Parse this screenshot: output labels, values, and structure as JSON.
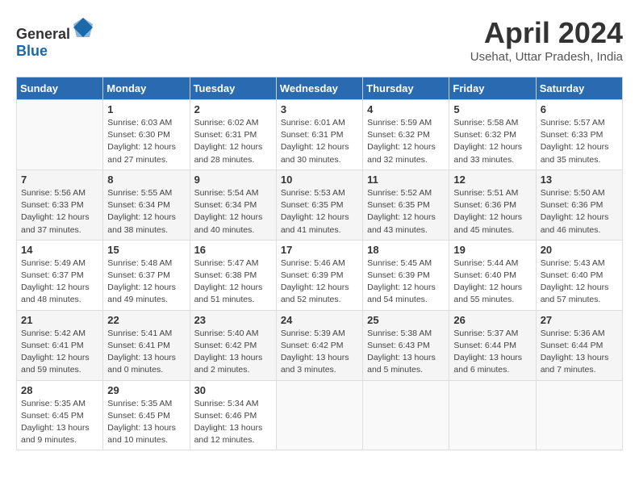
{
  "header": {
    "logo_general": "General",
    "logo_blue": "Blue",
    "month_year": "April 2024",
    "location": "Usehat, Uttar Pradesh, India"
  },
  "weekdays": [
    "Sunday",
    "Monday",
    "Tuesday",
    "Wednesday",
    "Thursday",
    "Friday",
    "Saturday"
  ],
  "rows": [
    [
      {
        "day": "",
        "info": ""
      },
      {
        "day": "1",
        "info": "Sunrise: 6:03 AM\nSunset: 6:30 PM\nDaylight: 12 hours\nand 27 minutes."
      },
      {
        "day": "2",
        "info": "Sunrise: 6:02 AM\nSunset: 6:31 PM\nDaylight: 12 hours\nand 28 minutes."
      },
      {
        "day": "3",
        "info": "Sunrise: 6:01 AM\nSunset: 6:31 PM\nDaylight: 12 hours\nand 30 minutes."
      },
      {
        "day": "4",
        "info": "Sunrise: 5:59 AM\nSunset: 6:32 PM\nDaylight: 12 hours\nand 32 minutes."
      },
      {
        "day": "5",
        "info": "Sunrise: 5:58 AM\nSunset: 6:32 PM\nDaylight: 12 hours\nand 33 minutes."
      },
      {
        "day": "6",
        "info": "Sunrise: 5:57 AM\nSunset: 6:33 PM\nDaylight: 12 hours\nand 35 minutes."
      }
    ],
    [
      {
        "day": "7",
        "info": "Sunrise: 5:56 AM\nSunset: 6:33 PM\nDaylight: 12 hours\nand 37 minutes."
      },
      {
        "day": "8",
        "info": "Sunrise: 5:55 AM\nSunset: 6:34 PM\nDaylight: 12 hours\nand 38 minutes."
      },
      {
        "day": "9",
        "info": "Sunrise: 5:54 AM\nSunset: 6:34 PM\nDaylight: 12 hours\nand 40 minutes."
      },
      {
        "day": "10",
        "info": "Sunrise: 5:53 AM\nSunset: 6:35 PM\nDaylight: 12 hours\nand 41 minutes."
      },
      {
        "day": "11",
        "info": "Sunrise: 5:52 AM\nSunset: 6:35 PM\nDaylight: 12 hours\nand 43 minutes."
      },
      {
        "day": "12",
        "info": "Sunrise: 5:51 AM\nSunset: 6:36 PM\nDaylight: 12 hours\nand 45 minutes."
      },
      {
        "day": "13",
        "info": "Sunrise: 5:50 AM\nSunset: 6:36 PM\nDaylight: 12 hours\nand 46 minutes."
      }
    ],
    [
      {
        "day": "14",
        "info": "Sunrise: 5:49 AM\nSunset: 6:37 PM\nDaylight: 12 hours\nand 48 minutes."
      },
      {
        "day": "15",
        "info": "Sunrise: 5:48 AM\nSunset: 6:37 PM\nDaylight: 12 hours\nand 49 minutes."
      },
      {
        "day": "16",
        "info": "Sunrise: 5:47 AM\nSunset: 6:38 PM\nDaylight: 12 hours\nand 51 minutes."
      },
      {
        "day": "17",
        "info": "Sunrise: 5:46 AM\nSunset: 6:39 PM\nDaylight: 12 hours\nand 52 minutes."
      },
      {
        "day": "18",
        "info": "Sunrise: 5:45 AM\nSunset: 6:39 PM\nDaylight: 12 hours\nand 54 minutes."
      },
      {
        "day": "19",
        "info": "Sunrise: 5:44 AM\nSunset: 6:40 PM\nDaylight: 12 hours\nand 55 minutes."
      },
      {
        "day": "20",
        "info": "Sunrise: 5:43 AM\nSunset: 6:40 PM\nDaylight: 12 hours\nand 57 minutes."
      }
    ],
    [
      {
        "day": "21",
        "info": "Sunrise: 5:42 AM\nSunset: 6:41 PM\nDaylight: 12 hours\nand 59 minutes."
      },
      {
        "day": "22",
        "info": "Sunrise: 5:41 AM\nSunset: 6:41 PM\nDaylight: 13 hours\nand 0 minutes."
      },
      {
        "day": "23",
        "info": "Sunrise: 5:40 AM\nSunset: 6:42 PM\nDaylight: 13 hours\nand 2 minutes."
      },
      {
        "day": "24",
        "info": "Sunrise: 5:39 AM\nSunset: 6:42 PM\nDaylight: 13 hours\nand 3 minutes."
      },
      {
        "day": "25",
        "info": "Sunrise: 5:38 AM\nSunset: 6:43 PM\nDaylight: 13 hours\nand 5 minutes."
      },
      {
        "day": "26",
        "info": "Sunrise: 5:37 AM\nSunset: 6:44 PM\nDaylight: 13 hours\nand 6 minutes."
      },
      {
        "day": "27",
        "info": "Sunrise: 5:36 AM\nSunset: 6:44 PM\nDaylight: 13 hours\nand 7 minutes."
      }
    ],
    [
      {
        "day": "28",
        "info": "Sunrise: 5:35 AM\nSunset: 6:45 PM\nDaylight: 13 hours\nand 9 minutes."
      },
      {
        "day": "29",
        "info": "Sunrise: 5:35 AM\nSunset: 6:45 PM\nDaylight: 13 hours\nand 10 minutes."
      },
      {
        "day": "30",
        "info": "Sunrise: 5:34 AM\nSunset: 6:46 PM\nDaylight: 13 hours\nand 12 minutes."
      },
      {
        "day": "",
        "info": ""
      },
      {
        "day": "",
        "info": ""
      },
      {
        "day": "",
        "info": ""
      },
      {
        "day": "",
        "info": ""
      }
    ]
  ]
}
